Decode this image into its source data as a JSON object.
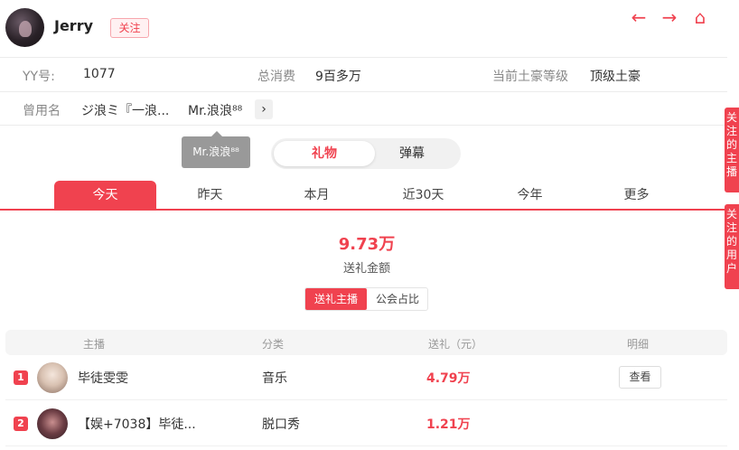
{
  "header": {
    "username": "Jerry",
    "follow_label": "关注",
    "nav": {
      "back_icon": "←",
      "forward_icon": "→",
      "home_icon": "⌂"
    }
  },
  "info": {
    "yy_label": "YY号:",
    "yy_value": "1077",
    "spend_label": "总消费",
    "spend_value": "9百多万",
    "level_label": "当前土豪等级",
    "level_value": "顶级土豪",
    "alias_label": "曾用名",
    "alias_1": "ジ浪ミ『一浪...",
    "alias_2": "Mr.浪浪⁸⁸",
    "more_icon": "›"
  },
  "tooltip": {
    "text": "Mr.浪浪⁸⁸"
  },
  "segment": {
    "gift": "礼物",
    "danmu": "弹幕"
  },
  "periods": [
    "今天",
    "昨天",
    "本月",
    "近30天",
    "今年",
    "更多"
  ],
  "summary": {
    "value": "9.73万",
    "label": "送礼金额"
  },
  "subsegment": {
    "anchor": "送礼主播",
    "guild": "公会占比"
  },
  "table": {
    "headers": [
      "主播",
      "分类",
      "送礼（元）",
      "明细"
    ],
    "rows": [
      {
        "rank": "1",
        "name": "毕徒雯雯",
        "category": "音乐",
        "amount": "4.79万",
        "action": "查看"
      },
      {
        "rank": "2",
        "name": "【娱+7038】毕徒...",
        "category": "脱口秀",
        "amount": "1.21万",
        "action": ""
      }
    ]
  },
  "side_tabs": {
    "tab1": "关注的主播",
    "tab2": "关注的用户"
  },
  "colors": {
    "accent": "#f0424f"
  }
}
